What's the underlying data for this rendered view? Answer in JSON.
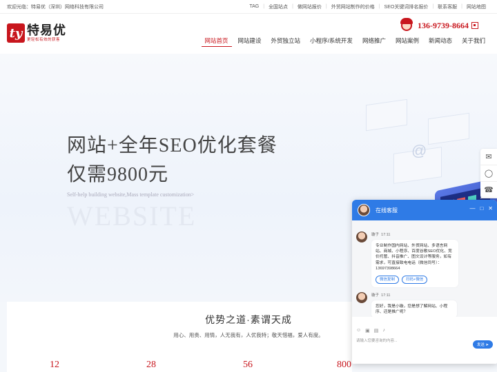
{
  "topbar": {
    "welcome": "欢迎光临：特易优（深圳）网络科技有限公司",
    "links": [
      "TAG",
      "全国站点",
      "做网站报价",
      "外贸网站制作的价格",
      "SEO关键词排名报价",
      "联系客服",
      "网站地图"
    ]
  },
  "header": {
    "logo_mark": "ty",
    "logo_name": "特易优",
    "logo_slogan": "更轻松有效的获客",
    "phone": "136-9739-8664"
  },
  "nav": [
    {
      "label": "网站首页",
      "active": true
    },
    {
      "label": "网站建设"
    },
    {
      "label": "外贸独立站"
    },
    {
      "label": "小程序/系统开发"
    },
    {
      "label": "网络推广"
    },
    {
      "label": "网站案例"
    },
    {
      "label": "新闻动态"
    },
    {
      "label": "关于我们"
    }
  ],
  "banner": {
    "line1": "网站+全年SEO优化套餐",
    "line2": "仅需9800元",
    "subtitle": "Self-help building website,Mass template customization>",
    "watermark": "WEBSITE"
  },
  "advantage": {
    "title": "优势之道·素谓天成",
    "desc": "用心、用责、用情，人无我有，人优我特；敬天惜福，爱人有度。",
    "stats": [
      "12",
      "28",
      "56",
      "800"
    ]
  },
  "side_icons": [
    "chat-icon",
    "qq-icon",
    "phone-icon"
  ],
  "chat": {
    "title": "在线客服",
    "messages": [
      {
        "sender": "璇子",
        "time": "17:11",
        "text": "专业制作国内网站、外贸网站、多语言网站、商城、小程序、百度谷歌SEO优化、竞价托管、抖音推广、图文设计等服务，如有需求，可直接致电电话（微信同号）：13697398664",
        "buttons": [
          "微信复制",
          "扫码+微信"
        ]
      },
      {
        "sender": "璇子",
        "time": "17:11",
        "text": "您好，我是小璇，您是想了解网站、小程序、还是推广呢？"
      }
    ],
    "input_placeholder": "请输入您要咨询的内容...",
    "send_label": "发送"
  },
  "colors": {
    "brand": "#c8161d",
    "chat_blue": "#2f7be6"
  }
}
